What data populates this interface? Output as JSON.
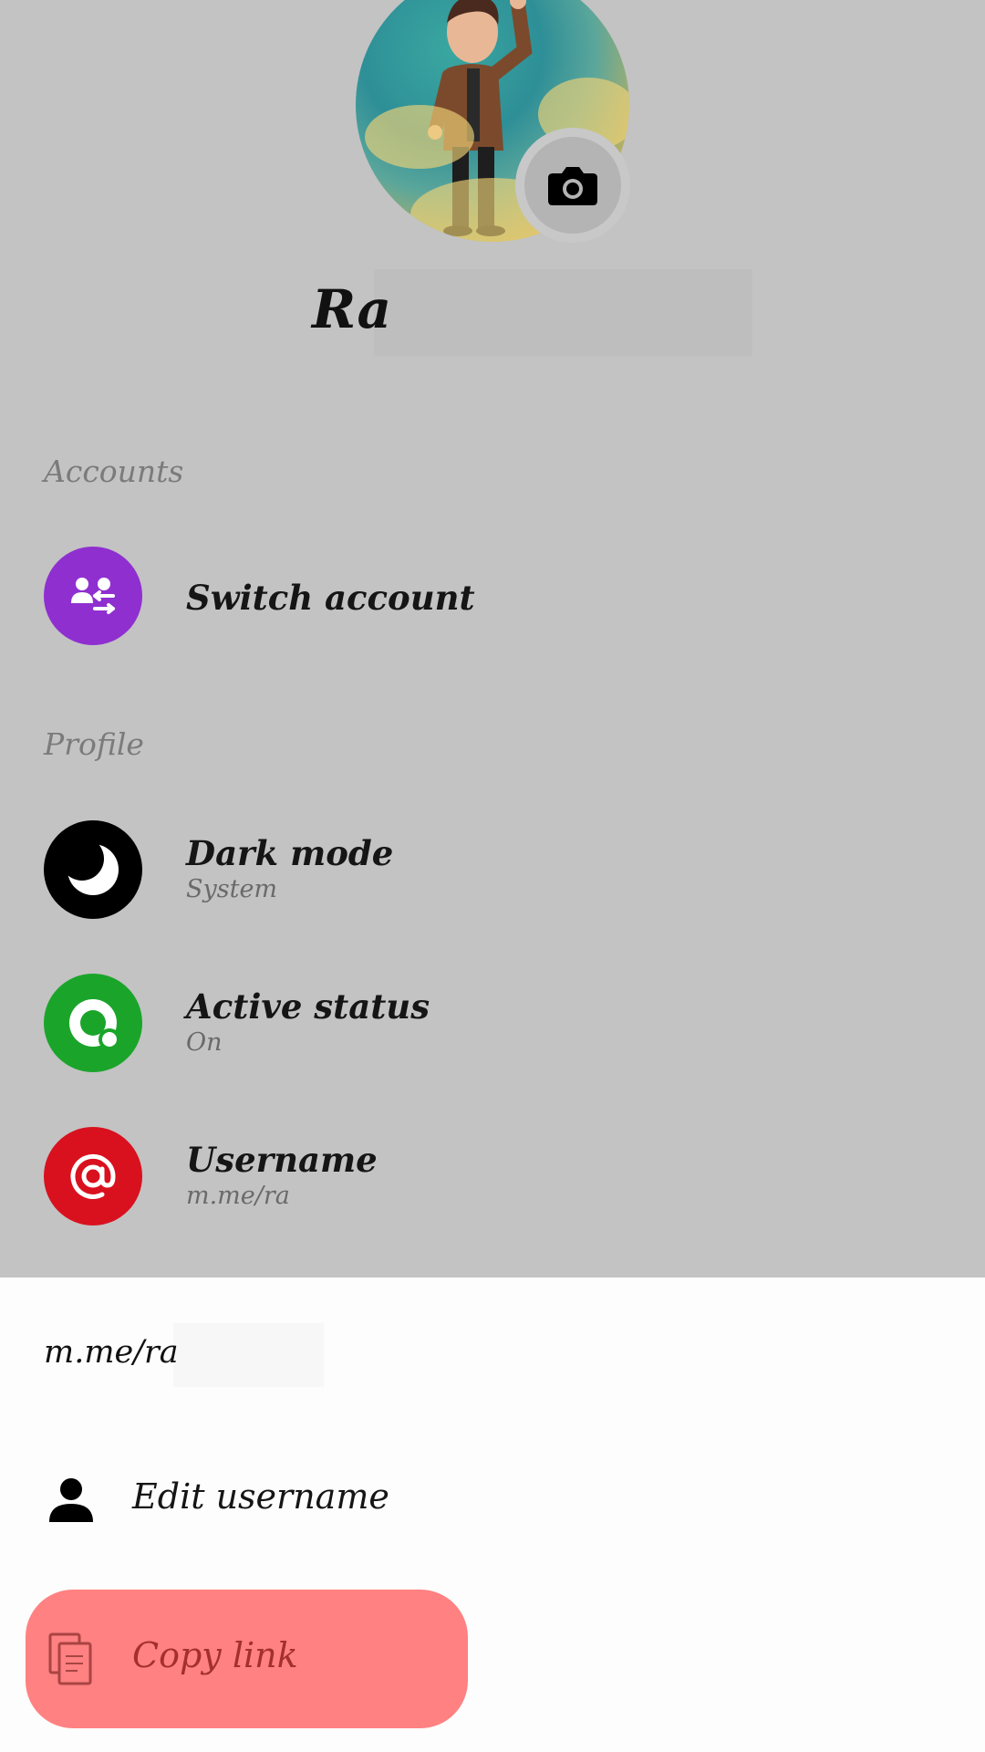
{
  "profile": {
    "name": "Ra"
  },
  "sections": {
    "accounts_label": "Accounts",
    "profile_label": "Profile"
  },
  "accounts": {
    "switch_account": "Switch account"
  },
  "settings": {
    "dark_mode": {
      "title": "Dark mode",
      "value": "System"
    },
    "active_status": {
      "title": "Active status",
      "value": "On"
    },
    "username": {
      "title": "Username",
      "value": "m.me/ra"
    }
  },
  "sheet": {
    "link": "m.me/ra",
    "edit_username": "Edit username",
    "copy_link": "Copy link"
  },
  "colors": {
    "switch_account": "#8f2fd0",
    "dark_mode": "#000000",
    "active_status": "#1aa52a",
    "username": "#d9111f",
    "highlight": "#ff8181"
  }
}
